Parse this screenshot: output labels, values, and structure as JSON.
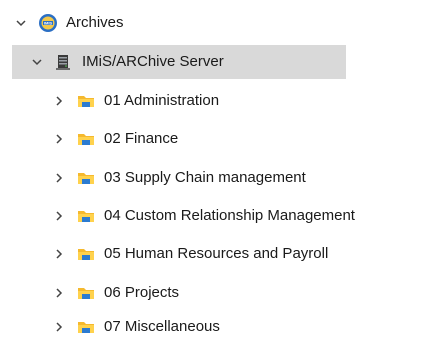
{
  "tree": {
    "root": {
      "label": "Archives",
      "icon": "imis-logo-icon",
      "expanded": true
    },
    "server": {
      "label": "IMiS/ARChive Server",
      "icon": "server-icon",
      "expanded": true,
      "selected": true
    },
    "folders": [
      {
        "label": "01 Administration",
        "icon": "folder-icon",
        "expanded": false
      },
      {
        "label": "02 Finance",
        "icon": "folder-icon",
        "expanded": false
      },
      {
        "label": "03 Supply Chain management",
        "icon": "folder-icon",
        "expanded": false
      },
      {
        "label": "04 Custom Relationship Management",
        "icon": "folder-icon",
        "expanded": false
      },
      {
        "label": "05 Human Resources and Payroll",
        "icon": "folder-icon",
        "expanded": false
      },
      {
        "label": "06 Projects",
        "icon": "folder-icon",
        "expanded": false
      },
      {
        "label": "07 Miscellaneous",
        "icon": "folder-icon",
        "expanded": false
      }
    ]
  },
  "colors": {
    "selection": "#d9d9d9",
    "folder_top": "#ffd24d",
    "folder_body": "#f5b92e",
    "folder_accent": "#2b7bd1",
    "chevron": "#444444"
  }
}
